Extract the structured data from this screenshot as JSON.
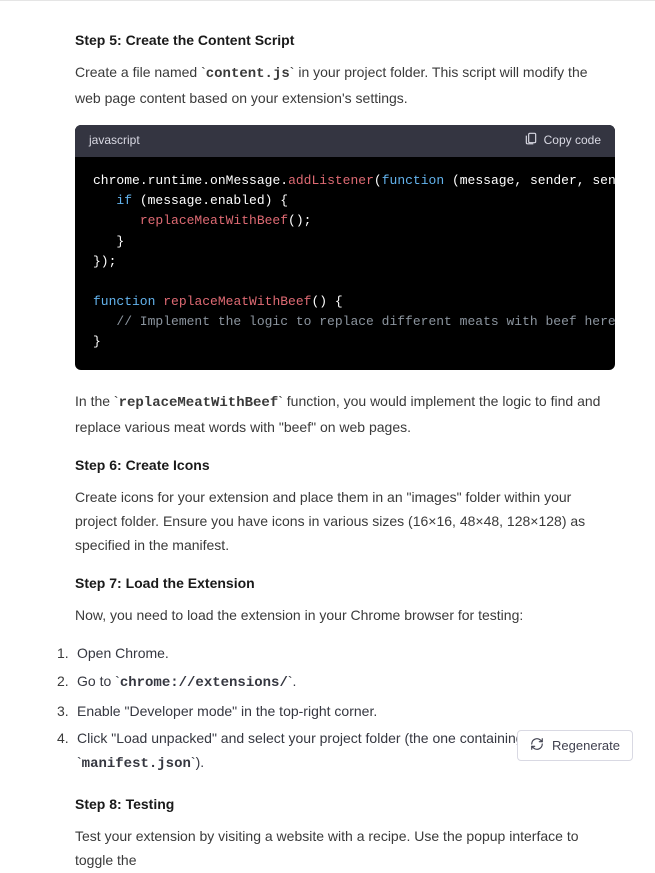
{
  "step5": {
    "heading": "Step 5: Create the Content Script",
    "para_pre": "Create a file named ",
    "code": "content.js",
    "para_post": " in your project folder. This script will modify the web page content based on your extension's settings."
  },
  "codeblock": {
    "lang": "javascript",
    "copy_label": "Copy code",
    "tokens": {
      "l1a": "chrome",
      "l1b": ".",
      "l1c": "runtime",
      "l1d": ".",
      "l1e": "onMessage",
      "l1f": ".",
      "l1g": "addListener",
      "l1h": "(",
      "l1i": "function",
      "l1j": " (",
      "l1k": "message, sender, sendResponse",
      "l2a": "   ",
      "l2b": "if",
      "l2c": " (message.enabled) {",
      "l3a": "      ",
      "l3b": "replaceMeatWithBeef",
      "l3c": "();",
      "l4": "   }",
      "l5": "});",
      "blank": "",
      "l7a": "function",
      "l7b": " ",
      "l7c": "replaceMeatWithBeef",
      "l7d": "() {",
      "l8a": "   ",
      "l8b": "// Implement the logic to replace different meats with beef here",
      "l9": "}"
    }
  },
  "after_code": {
    "pre": "In the ",
    "code": "replaceMeatWithBeef",
    "post": " function, you would implement the logic to find and replace various meat words with \"beef\" on web pages."
  },
  "step6": {
    "heading": "Step 6: Create Icons",
    "para": "Create icons for your extension and place them in an \"images\" folder within your project folder. Ensure you have icons in various sizes (16×16, 48×48, 128×128) as specified in the manifest."
  },
  "step7": {
    "heading": "Step 7: Load the Extension",
    "para": "Now, you need to load the extension in your Chrome browser for testing:",
    "items": {
      "i1": "Open Chrome.",
      "i2_pre": "Go to ",
      "i2_code": "chrome://extensions/",
      "i2_post": ".",
      "i3": "Enable \"Developer mode\" in the top-right corner.",
      "i4_pre": "Click \"Load unpacked\" and select your project folder (the one containing ",
      "i4_code": "manifest.json",
      "i4_post": ")."
    }
  },
  "step8": {
    "heading": "Step 8: Testing",
    "para": "Test your extension by visiting a website with a recipe. Use the popup interface to toggle the"
  },
  "regen_label": "Regenerate"
}
